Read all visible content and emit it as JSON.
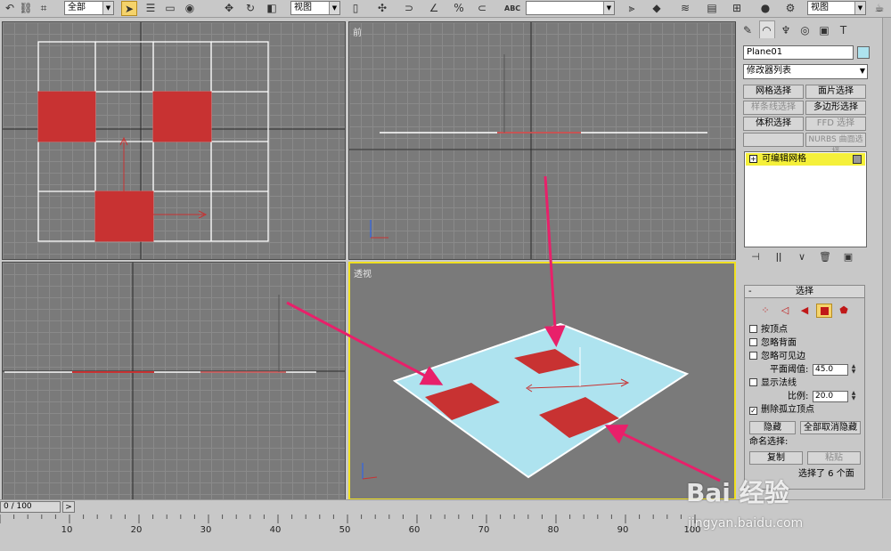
{
  "toolbar": {
    "selection_filter": "全部",
    "ref_coord": "视图",
    "render_view": "视图",
    "snap_label": "ABC",
    "icons": [
      "pointer-icon",
      "select-by-name-icon",
      "rect-select-icon",
      "window-crossing-icon",
      "move-icon",
      "rotate-icon",
      "scale-icon",
      "mirror-icon",
      "align-icon",
      "layer-icon",
      "curve-editor-icon",
      "schematic-icon",
      "material-editor-icon",
      "render-setup-icon",
      "render-icon",
      "teapot-icon"
    ]
  },
  "viewports": {
    "top": {
      "label": ""
    },
    "front": {
      "label": "前"
    },
    "left": {
      "label": ""
    },
    "perspective": {
      "label": "透视"
    }
  },
  "command_panel": {
    "tabs": [
      "create-tab-icon",
      "modify-tab-icon",
      "hierarchy-tab-icon",
      "motion-tab-icon",
      "display-tab-icon",
      "utilities-tab-icon"
    ],
    "object_name": "Plane01",
    "object_color": "#aee3ef",
    "modifier_list": "修改器列表",
    "modifier_buttons": [
      {
        "label": "网格选择",
        "enabled": true
      },
      {
        "label": "面片选择",
        "enabled": true
      },
      {
        "label": "样条线选择",
        "enabled": false
      },
      {
        "label": "多边形选择",
        "enabled": true
      },
      {
        "label": "体积选择",
        "enabled": true
      },
      {
        "label": "FFD 选择",
        "enabled": false
      },
      {
        "label": "",
        "enabled": false
      },
      {
        "label": "NURBS 曲面选择",
        "enabled": false
      }
    ],
    "stack_item": "可编辑网格",
    "stack_plus": "+"
  },
  "selection_rollout": {
    "minus": "-",
    "title": "选择",
    "by_vertex": "按顶点",
    "ignore_backfacing": "忽略背面",
    "ignore_visible_edges": "忽略可见边",
    "planar_threshold_label": "平面阈值:",
    "planar_threshold_value": "45.0",
    "show_normals": "显示法线",
    "scale_label": "比例:",
    "scale_value": "20.0",
    "delete_isolated": "删除孤立顶点",
    "delete_isolated_checked": "✓",
    "hide_button": "隐藏",
    "unhide_all_button": "全部取消隐藏",
    "named_selections_label": "命名选择:",
    "copy_button": "复制",
    "paste_button": "粘贴",
    "status": "选择了 6 个面"
  },
  "timeline": {
    "frame": "0 / 100",
    "arrow": ">"
  },
  "ruler": {
    "labels": [
      "10",
      "20",
      "30",
      "40",
      "50",
      "60",
      "70",
      "80",
      "90",
      "100"
    ]
  },
  "watermark": {
    "logo": "Bai  经验",
    "url": "jingyan.baidu.com"
  },
  "colors": {
    "selected_face": "#c83232",
    "plane": "#aee3ef",
    "grid": "#8a8a8a",
    "viewport_bg": "#7a7a7a",
    "active_border": "#f0e020",
    "arrow": "#e8206a"
  }
}
